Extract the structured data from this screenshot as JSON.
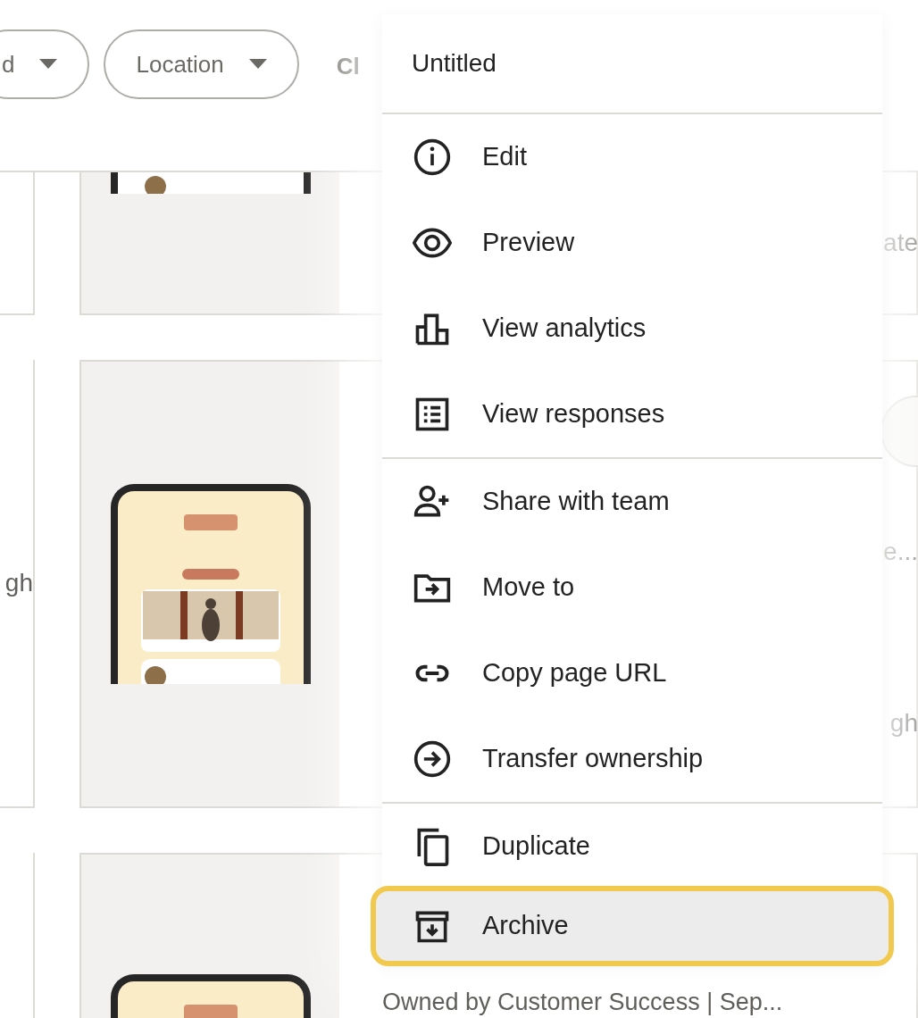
{
  "filters": [
    {
      "label": "d"
    },
    {
      "label": "Location"
    }
  ],
  "filter_tail": "Cl",
  "card_rows": [
    {
      "right_text": "ate",
      "round_button": false
    },
    {
      "left_text": "gh",
      "right_texts": [
        "e...",
        "gh"
      ],
      "round_button": true
    },
    {
      "caption": "Owned by Customer Success  |  Sep...",
      "round_button": false
    }
  ],
  "menu": {
    "title": "Untitled",
    "sections": [
      [
        {
          "label": "Edit",
          "selected": false
        },
        {
          "label": "Preview",
          "selected": false
        },
        {
          "label": "View analytics",
          "selected": false
        },
        {
          "label": "View responses",
          "selected": false
        }
      ],
      [
        {
          "label": "Share with team",
          "selected": false
        },
        {
          "label": "Move to",
          "selected": false
        },
        {
          "label": "Copy page URL",
          "selected": false
        },
        {
          "label": "Transfer ownership",
          "selected": false
        }
      ],
      [
        {
          "label": "Duplicate",
          "selected": false
        },
        {
          "label": "Archive",
          "selected": true
        }
      ]
    ]
  }
}
